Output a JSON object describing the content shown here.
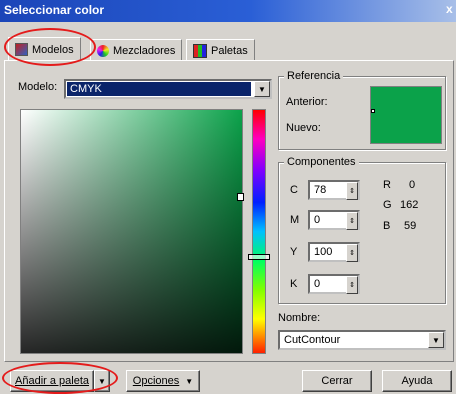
{
  "window": {
    "title": "Seleccionar color"
  },
  "tabs": [
    {
      "label": "Modelos",
      "icon": "models-icon"
    },
    {
      "label": "Mezcladores",
      "icon": "mixers-icon"
    },
    {
      "label": "Paletas",
      "icon": "palettes-icon"
    }
  ],
  "model": {
    "label": "Modelo:",
    "value": "CMYK"
  },
  "reference": {
    "title": "Referencia",
    "previous_label": "Anterior:",
    "new_label": "Nuevo:",
    "color": "#0ba24a"
  },
  "components": {
    "title": "Componentes",
    "cmyk": [
      {
        "key": "C",
        "value": "78"
      },
      {
        "key": "M",
        "value": "0"
      },
      {
        "key": "Y",
        "value": "100"
      },
      {
        "key": "K",
        "value": "0"
      }
    ],
    "rgb": [
      {
        "key": "R",
        "value": "0"
      },
      {
        "key": "G",
        "value": "162"
      },
      {
        "key": "B",
        "value": "59"
      }
    ]
  },
  "name": {
    "label": "Nombre:",
    "value": "CutContour"
  },
  "buttons": {
    "add_to_palette": "Añadir a paleta",
    "options": "Opciones",
    "close": "Cerrar",
    "help": "Ayuda"
  },
  "annotation_color": "#e41b1b"
}
